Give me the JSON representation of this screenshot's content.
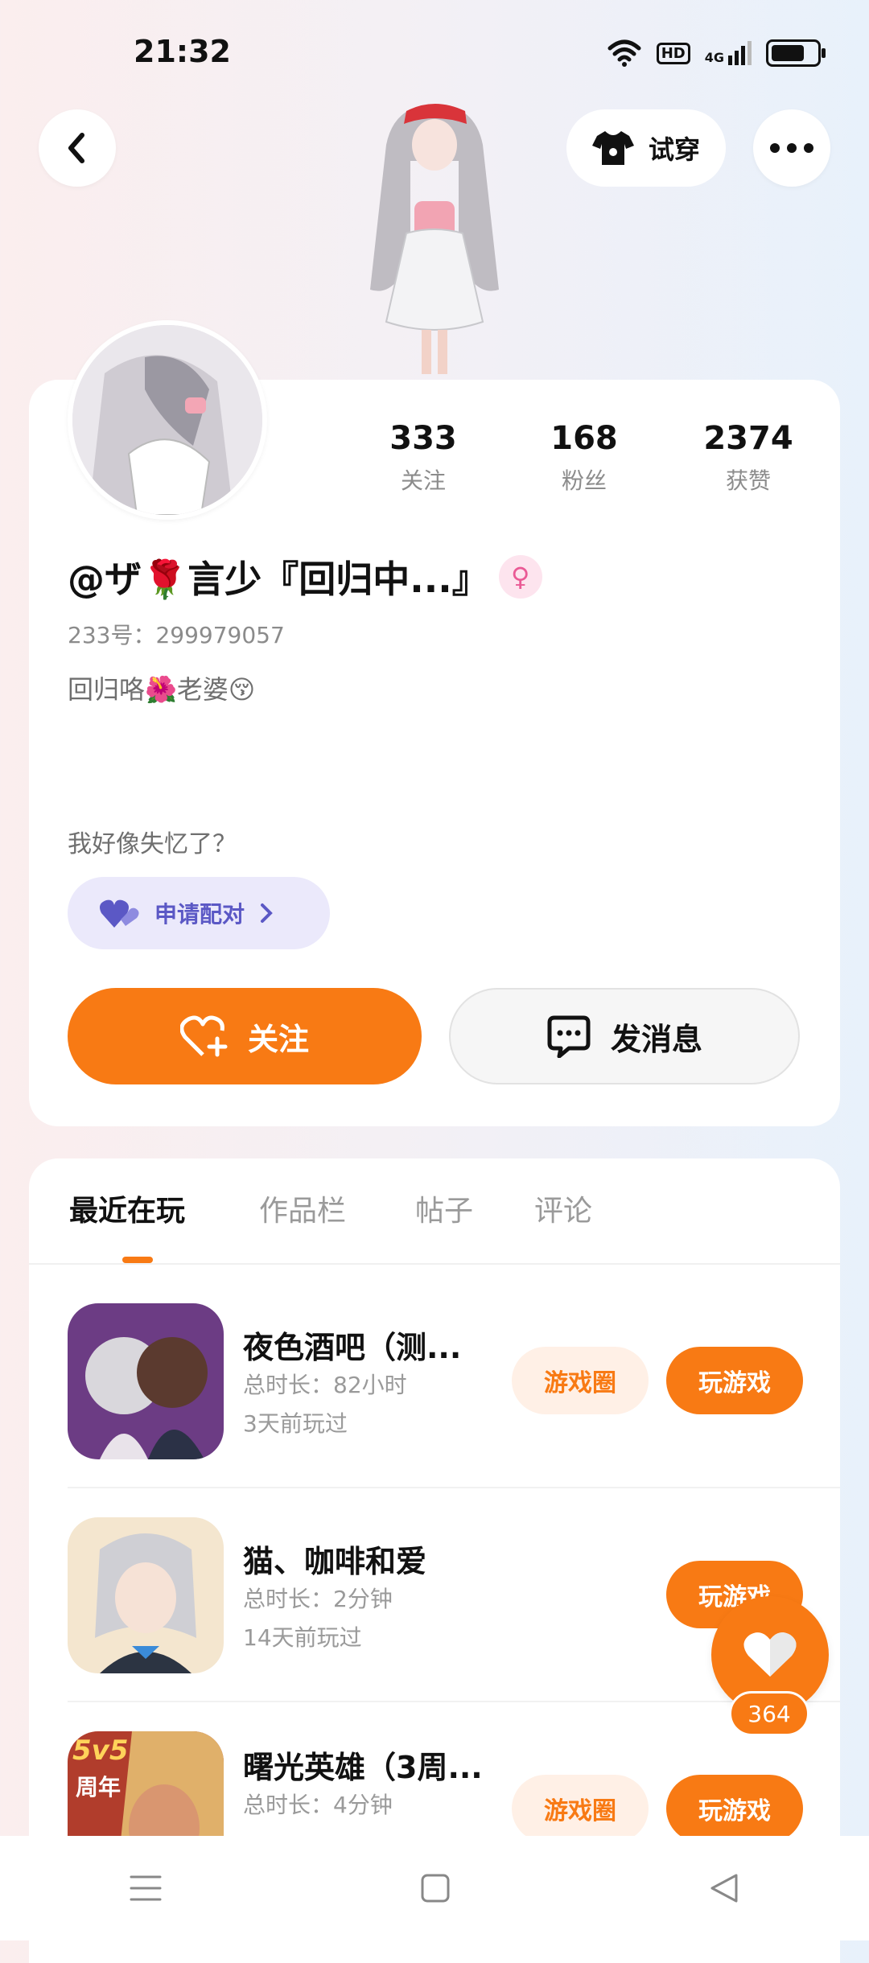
{
  "status_bar": {
    "time": "21:32",
    "network_badge": "HD",
    "network_type": "4G"
  },
  "header": {
    "try_on_label": "试穿"
  },
  "stats": [
    {
      "value": "333",
      "label": "关注"
    },
    {
      "value": "168",
      "label": "粉丝"
    },
    {
      "value": "2374",
      "label": "获赞"
    }
  ],
  "profile": {
    "nickname": "@ザ🌹言少『回归中...』",
    "gender_symbol": "♀",
    "uid": "233号：299979057",
    "bio_line1": "回归咯🌺老婆😚",
    "bio_line2": "我好像失忆了？",
    "pair_label": "申请配对",
    "follow_label": "关注",
    "message_label": "发消息"
  },
  "tabs": [
    {
      "label": "最近在玩",
      "active": true
    },
    {
      "label": "作品栏",
      "active": false
    },
    {
      "label": "帖子",
      "active": false
    },
    {
      "label": "评论",
      "active": false
    }
  ],
  "games": [
    {
      "title": "夜色酒吧（测...",
      "duration": "总时长：82小时",
      "last_played": "3天前玩过",
      "circle_label": "游戏圈",
      "play_label": "玩游戏",
      "show_circle": true
    },
    {
      "title": "猫、咖啡和爱",
      "duration": "总时长：2分钟",
      "last_played": "14天前玩过",
      "circle_label": "",
      "play_label": "玩游戏",
      "show_circle": false
    },
    {
      "title": "曙光英雄（3周...",
      "duration": "总时长：4分钟",
      "last_played": "",
      "circle_label": "游戏圈",
      "play_label": "玩游戏",
      "show_circle": true,
      "icon_badge": "5v5",
      "icon_badge2": "周年"
    }
  ],
  "like_fab": {
    "count": "364"
  },
  "colors": {
    "accent": "#f87a14",
    "pair": "#5b58c5",
    "gender": "#ea5a95"
  }
}
